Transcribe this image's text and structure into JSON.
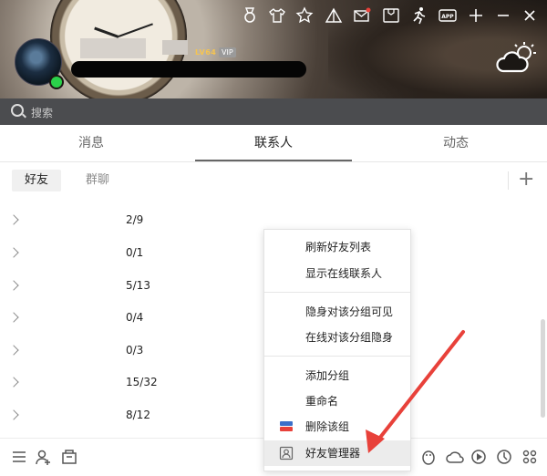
{
  "header": {
    "level": "LV64",
    "vip": "VIP"
  },
  "search": {
    "placeholder": "搜索"
  },
  "tabs": [
    {
      "label": "消息"
    },
    {
      "label": "联系人"
    },
    {
      "label": "动态"
    }
  ],
  "subtabs": [
    {
      "label": "好友"
    },
    {
      "label": "群聊"
    }
  ],
  "groups": [
    {
      "count": "2/9"
    },
    {
      "count": "0/1"
    },
    {
      "count": "5/13"
    },
    {
      "count": "0/4"
    },
    {
      "count": "0/3"
    },
    {
      "count": "15/32"
    },
    {
      "count": "8/12"
    }
  ],
  "menu": {
    "refresh": "刷新好友列表",
    "show_online": "显示在线联系人",
    "invisible_visible": "隐身对该分组可见",
    "online_invisible": "在线对该分组隐身",
    "add_group": "添加分组",
    "rename": "重命名",
    "delete_group": "删除该组",
    "friend_manager": "好友管理器"
  },
  "colors": {
    "accent_arrow": "#e8413a",
    "online": "#2ad24a"
  }
}
